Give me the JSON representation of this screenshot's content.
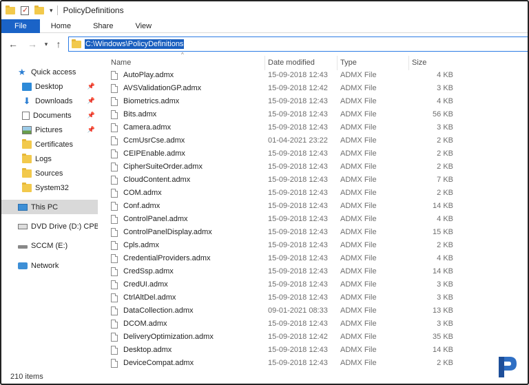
{
  "window": {
    "title": "PolicyDefinitions"
  },
  "ribbon": {
    "tabs": [
      "File",
      "Home",
      "Share",
      "View"
    ]
  },
  "address": {
    "path": "C:\\Windows\\PolicyDefinitions"
  },
  "sidebar": {
    "quick_access": "Quick access",
    "items": [
      {
        "label": "Desktop",
        "icon": "desktop-icon",
        "pinned": true
      },
      {
        "label": "Downloads",
        "icon": "download-icon",
        "pinned": true
      },
      {
        "label": "Documents",
        "icon": "documents-icon",
        "pinned": true
      },
      {
        "label": "Pictures",
        "icon": "pictures-icon",
        "pinned": true
      },
      {
        "label": "Certificates",
        "icon": "folder-icon",
        "pinned": false
      },
      {
        "label": "Logs",
        "icon": "folder-icon",
        "pinned": false
      },
      {
        "label": "Sources",
        "icon": "folder-icon",
        "pinned": false
      },
      {
        "label": "System32",
        "icon": "folder-icon",
        "pinned": false
      }
    ],
    "this_pc": "This PC",
    "dvd_drive": "DVD Drive (D:) CPBA_",
    "sccm": "SCCM (E:)",
    "network": "Network"
  },
  "columns": {
    "name": "Name",
    "date": "Date modified",
    "type": "Type",
    "size": "Size"
  },
  "files": [
    {
      "name": "AutoPlay.admx",
      "date": "15-09-2018 12:43",
      "type": "ADMX File",
      "size": "4 KB"
    },
    {
      "name": "AVSValidationGP.admx",
      "date": "15-09-2018 12:42",
      "type": "ADMX File",
      "size": "3 KB"
    },
    {
      "name": "Biometrics.admx",
      "date": "15-09-2018 12:43",
      "type": "ADMX File",
      "size": "4 KB"
    },
    {
      "name": "Bits.admx",
      "date": "15-09-2018 12:43",
      "type": "ADMX File",
      "size": "56 KB"
    },
    {
      "name": "Camera.admx",
      "date": "15-09-2018 12:43",
      "type": "ADMX File",
      "size": "3 KB"
    },
    {
      "name": "CcmUsrCse.admx",
      "date": "01-04-2021 23:22",
      "type": "ADMX File",
      "size": "2 KB"
    },
    {
      "name": "CEIPEnable.admx",
      "date": "15-09-2018 12:43",
      "type": "ADMX File",
      "size": "2 KB"
    },
    {
      "name": "CipherSuiteOrder.admx",
      "date": "15-09-2018 12:43",
      "type": "ADMX File",
      "size": "2 KB"
    },
    {
      "name": "CloudContent.admx",
      "date": "15-09-2018 12:43",
      "type": "ADMX File",
      "size": "7 KB"
    },
    {
      "name": "COM.admx",
      "date": "15-09-2018 12:43",
      "type": "ADMX File",
      "size": "2 KB"
    },
    {
      "name": "Conf.admx",
      "date": "15-09-2018 12:43",
      "type": "ADMX File",
      "size": "14 KB"
    },
    {
      "name": "ControlPanel.admx",
      "date": "15-09-2018 12:43",
      "type": "ADMX File",
      "size": "4 KB"
    },
    {
      "name": "ControlPanelDisplay.admx",
      "date": "15-09-2018 12:43",
      "type": "ADMX File",
      "size": "15 KB"
    },
    {
      "name": "Cpls.admx",
      "date": "15-09-2018 12:43",
      "type": "ADMX File",
      "size": "2 KB"
    },
    {
      "name": "CredentialProviders.admx",
      "date": "15-09-2018 12:43",
      "type": "ADMX File",
      "size": "4 KB"
    },
    {
      "name": "CredSsp.admx",
      "date": "15-09-2018 12:43",
      "type": "ADMX File",
      "size": "14 KB"
    },
    {
      "name": "CredUI.admx",
      "date": "15-09-2018 12:43",
      "type": "ADMX File",
      "size": "3 KB"
    },
    {
      "name": "CtrlAltDel.admx",
      "date": "15-09-2018 12:43",
      "type": "ADMX File",
      "size": "3 KB"
    },
    {
      "name": "DataCollection.admx",
      "date": "09-01-2021 08:33",
      "type": "ADMX File",
      "size": "13 KB"
    },
    {
      "name": "DCOM.admx",
      "date": "15-09-2018 12:43",
      "type": "ADMX File",
      "size": "3 KB"
    },
    {
      "name": "DeliveryOptimization.admx",
      "date": "15-09-2018 12:42",
      "type": "ADMX File",
      "size": "35 KB"
    },
    {
      "name": "Desktop.admx",
      "date": "15-09-2018 12:43",
      "type": "ADMX File",
      "size": "14 KB"
    },
    {
      "name": "DeviceCompat.admx",
      "date": "15-09-2018 12:43",
      "type": "ADMX File",
      "size": "2 KB"
    }
  ],
  "status": {
    "item_count": "210 items"
  },
  "colors": {
    "accent": "#1a63c7",
    "selection": "#1a5fbf",
    "folder": "#f2c94c"
  }
}
